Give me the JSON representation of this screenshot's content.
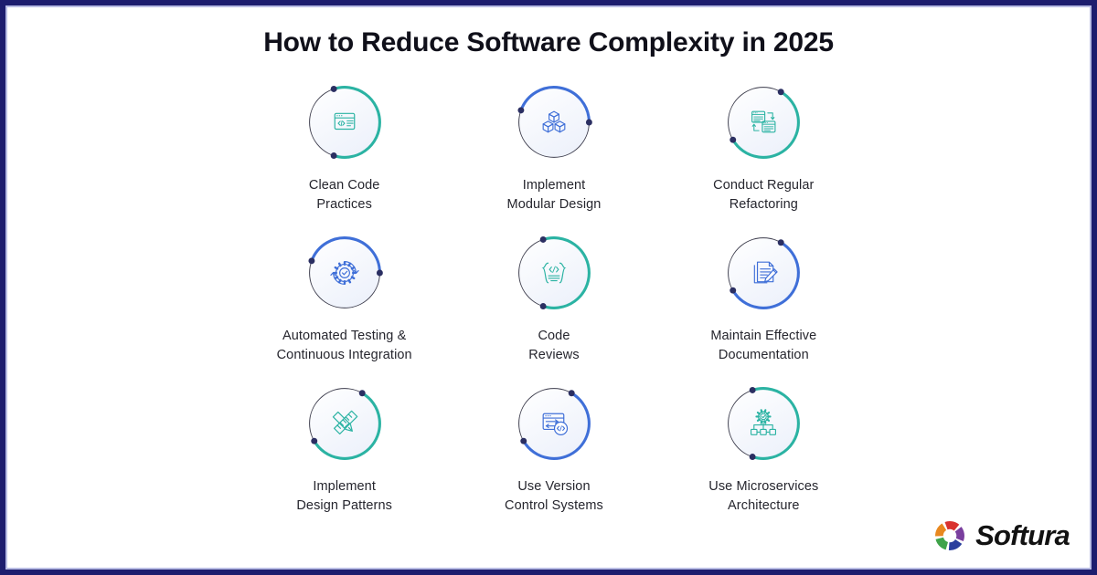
{
  "poster": {
    "title": "How to Reduce Software Complexity in 2025",
    "border_color": "#1d1d6e",
    "inner_line_color": "#b9bde4",
    "background": "#ffffff",
    "teal": "#2bb3a3",
    "blue": "#3f6fd8",
    "dot_color": "#2b2f62",
    "ring_color": "#3a3a4a",
    "label_color": "#26262e"
  },
  "items": [
    {
      "label": "Clean Code\nPractices",
      "icon": "code-window-icon",
      "accent": "teal",
      "accent_color": "#2bb3a3",
      "arc": "left"
    },
    {
      "label": "Implement\nModular Design",
      "icon": "cubes-icon",
      "accent": "blue",
      "accent_color": "#3f6fd8",
      "arc": "top"
    },
    {
      "label": "Conduct Regular\nRefactoring",
      "icon": "refactor-documents-icon",
      "accent": "teal",
      "accent_color": "#2bb3a3",
      "arc": "right"
    },
    {
      "label": "Automated Testing &\nContinuous Integration",
      "icon": "gear-check-cycle-icon",
      "accent": "blue",
      "accent_color": "#3f6fd8",
      "arc": "top"
    },
    {
      "label": "Code\nReviews",
      "icon": "braces-code-icon",
      "accent": "teal",
      "accent_color": "#2bb3a3",
      "arc": "left"
    },
    {
      "label": "Maintain Effective\nDocumentation",
      "icon": "document-pencil-icon",
      "accent": "blue",
      "accent_color": "#3f6fd8",
      "arc": "right"
    },
    {
      "label": "Implement\nDesign Patterns",
      "icon": "ruler-pencil-icon",
      "accent": "teal",
      "accent_color": "#2bb3a3",
      "arc": "right"
    },
    {
      "label": "Use Version\nControl Systems",
      "icon": "version-control-window-icon",
      "accent": "blue",
      "accent_color": "#3f6fd8",
      "arc": "right"
    },
    {
      "label": "Use Microservices\nArchitecture",
      "icon": "microservices-gear-icon",
      "accent": "teal",
      "accent_color": "#2bb3a3",
      "arc": "left"
    }
  ],
  "logo": {
    "name": "Softura",
    "mark": "aperture-swirl-logo",
    "colors": [
      "#d9322f",
      "#e8881f",
      "#3fa34a",
      "#2b3f9e",
      "#7a3f9e"
    ]
  }
}
